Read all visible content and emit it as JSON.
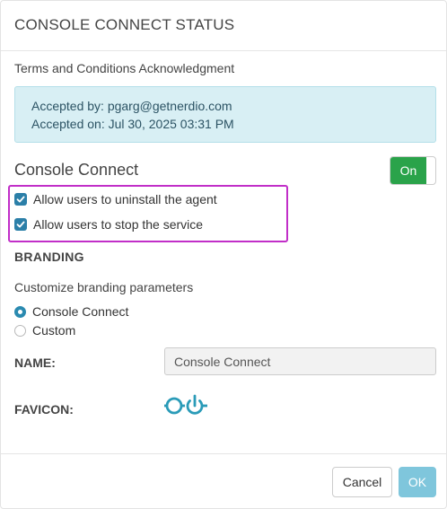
{
  "dialog": {
    "title": "CONSOLE CONNECT STATUS"
  },
  "terms": {
    "heading": "Terms and Conditions Acknowledgment",
    "accepted_by": "Accepted by: pgarg@getnerdio.com",
    "accepted_on": "Accepted on: Jul 30, 2025 03:31 PM"
  },
  "console_connect": {
    "label": "Console Connect",
    "toggle_label": "On",
    "toggle_state": true
  },
  "options": [
    {
      "label": "Allow users to uninstall the agent",
      "checked": true
    },
    {
      "label": "Allow users to stop the service",
      "checked": true
    }
  ],
  "branding": {
    "heading": "BRANDING",
    "description": "Customize branding parameters",
    "choices": [
      {
        "label": "Console Connect",
        "selected": true
      },
      {
        "label": "Custom",
        "selected": false
      }
    ],
    "name_label": "NAME:",
    "name_value": "Console Connect",
    "favicon_label": "FAVICON:",
    "favicon_icon": "glasses-power-icon"
  },
  "footer": {
    "cancel_label": "Cancel",
    "ok_label": "OK"
  },
  "colors": {
    "accent": "#2a8ab0",
    "toggle_on": "#2aa34a",
    "info_bg": "#d8eff4",
    "highlight": "#c12ec8",
    "ok_button": "#7fc6dc"
  }
}
